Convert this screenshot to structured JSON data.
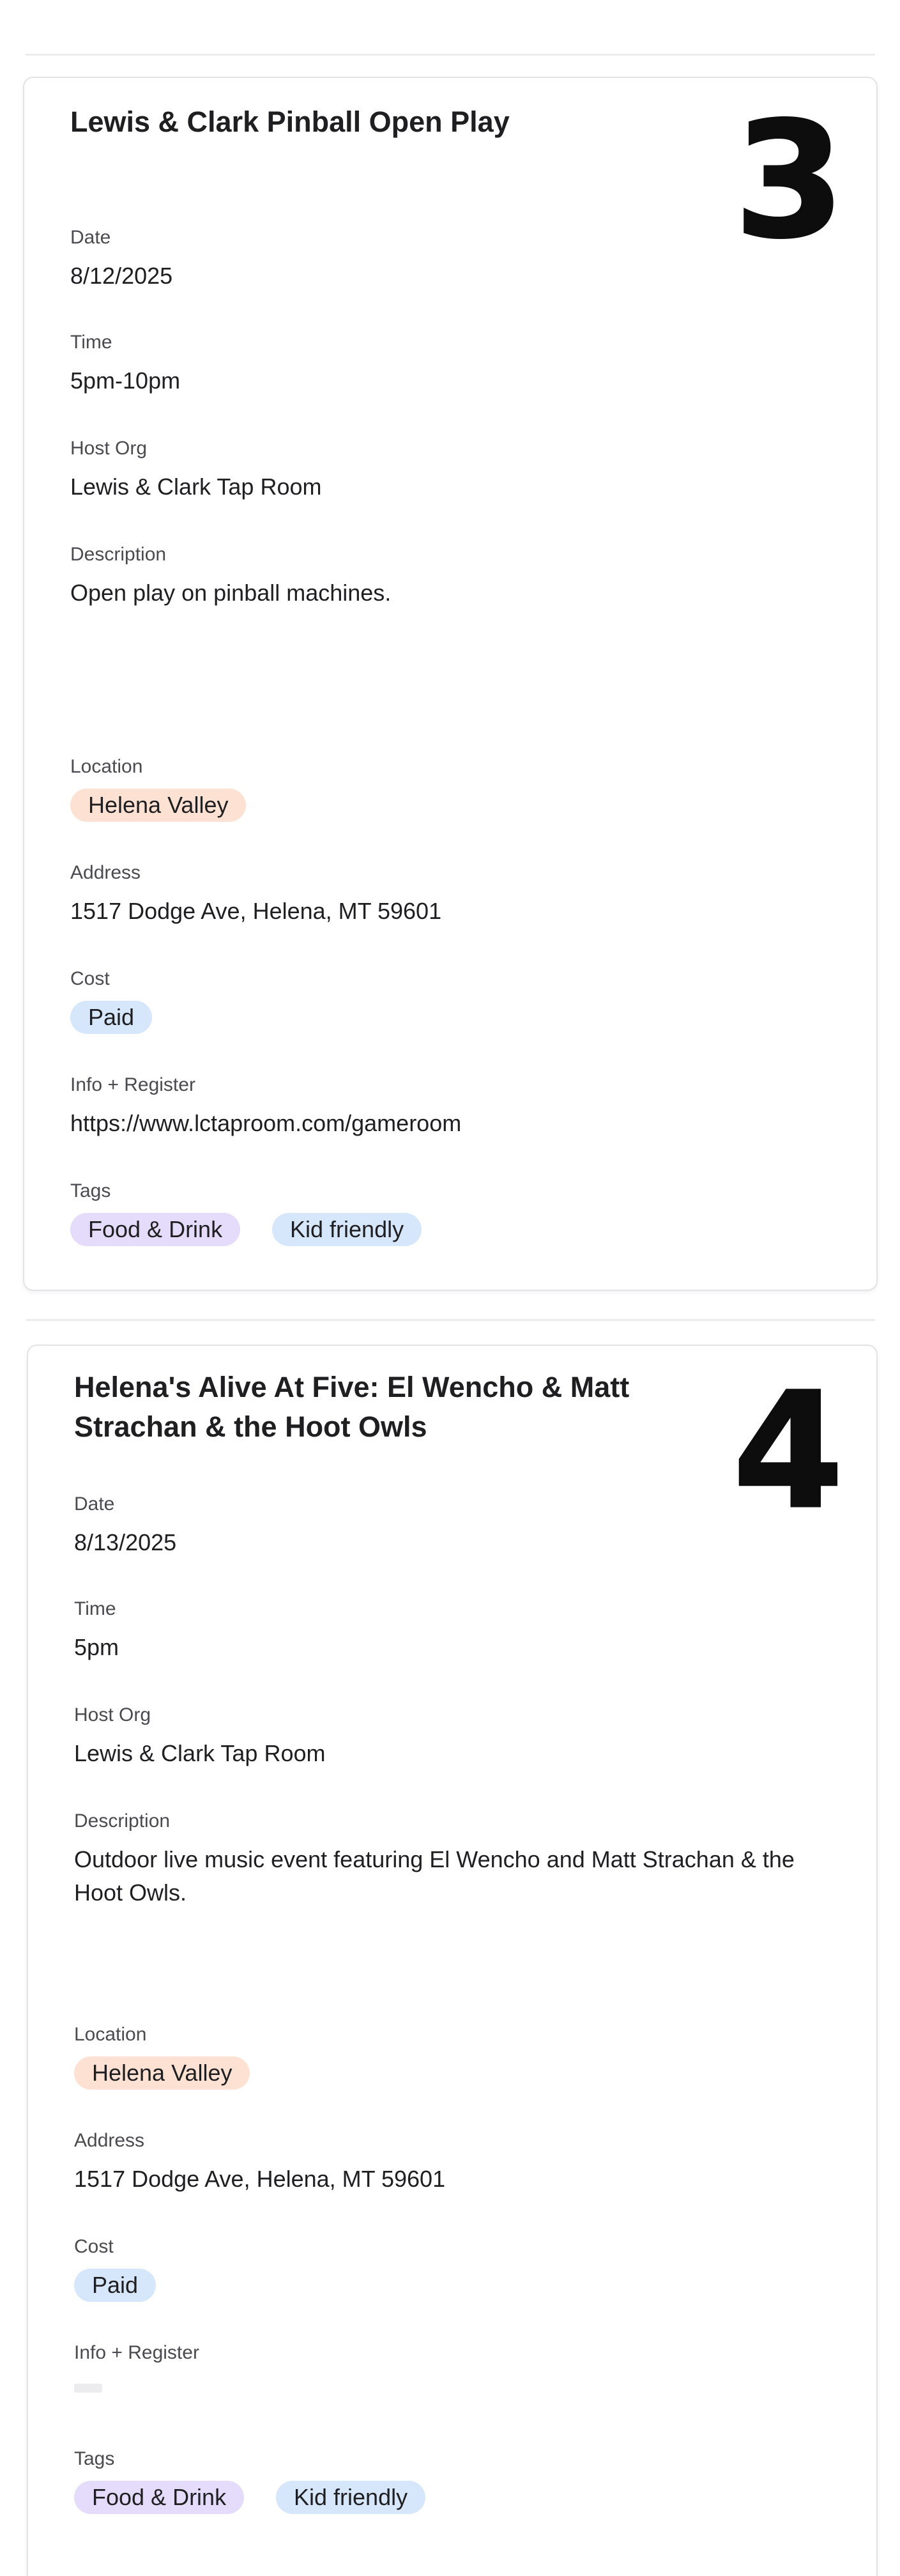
{
  "events": [
    {
      "badge_number": "3",
      "title": "Lewis & Clark Pinball Open Play",
      "date_label": "Date",
      "date": "8/12/2025",
      "time_label": "Time",
      "time": "5pm-10pm",
      "host_label": "Host Org",
      "host": "Lewis & Clark Tap Room",
      "description_label": "Description",
      "description": "Open play on pinball machines.",
      "location_label": "Location",
      "location": "Helena Valley",
      "address_label": "Address",
      "address": "1517 Dodge Ave, Helena, MT 59601",
      "cost_label": "Cost",
      "cost": "Paid",
      "info_label": "Info + Register",
      "info": "https://www.lctaproom.com/gameroom",
      "tags_label": "Tags",
      "tags": [
        "Food & Drink",
        "Kid friendly"
      ]
    },
    {
      "badge_number": "4",
      "title": "Helena's Alive At Five: El Wencho & Matt Strachan & the Hoot Owls",
      "date_label": "Date",
      "date": "8/13/2025",
      "time_label": "Time",
      "time": "5pm",
      "host_label": "Host Org",
      "host": "Lewis & Clark Tap Room",
      "description_label": "Description",
      "description": "Outdoor live music event featuring El Wencho and Matt Strachan & the Hoot Owls.",
      "location_label": "Location",
      "location": "Helena Valley",
      "address_label": "Address",
      "address": "1517 Dodge Ave, Helena, MT 59601",
      "cost_label": "Cost",
      "cost": "Paid",
      "info_label": "Info + Register",
      "info": "",
      "tags_label": "Tags",
      "tags": [
        "Food & Drink",
        "Kid friendly"
      ]
    }
  ],
  "colors": {
    "location_pill": "#fde1d3",
    "cost_pill": "#d6e6fb",
    "tag_food_pill": "#e4dcfa",
    "tag_kid_pill": "#d6e6fb"
  }
}
